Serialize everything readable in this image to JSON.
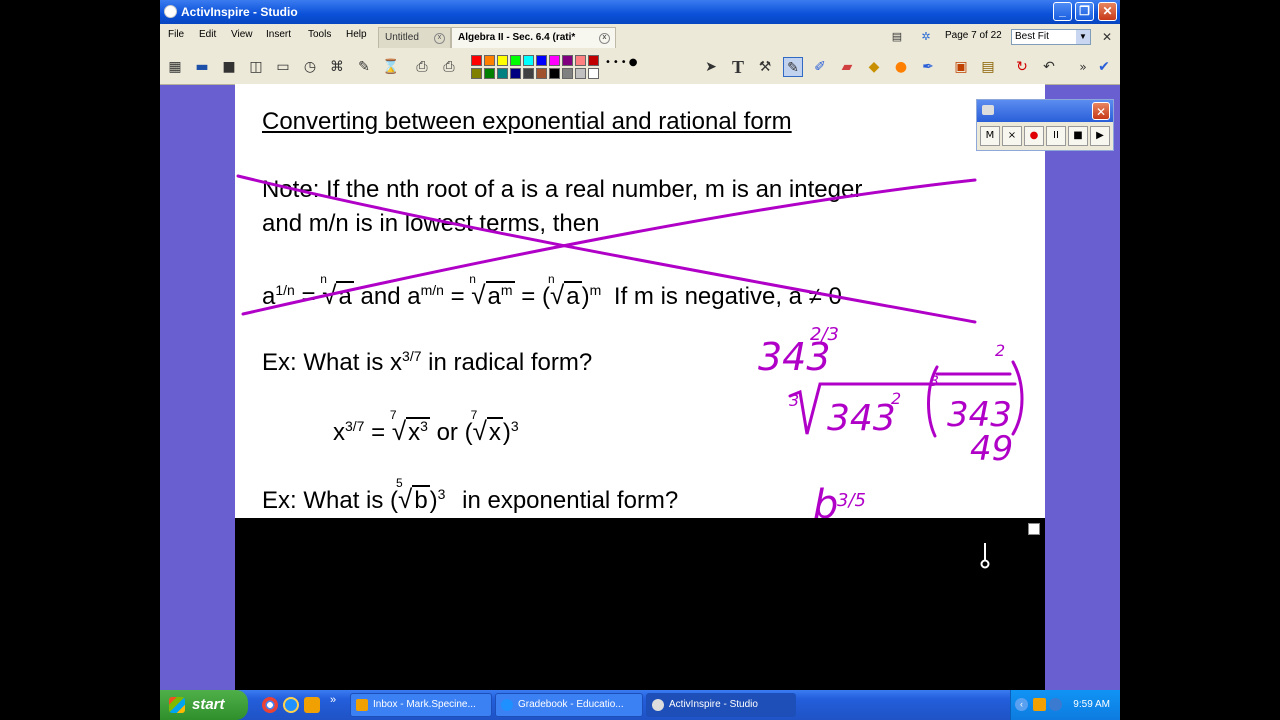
{
  "window": {
    "title": "ActivInspire - Studio",
    "controls": [
      "minimize",
      "maximize",
      "close"
    ]
  },
  "menubar": {
    "items": [
      "File",
      "Edit",
      "View",
      "Insert",
      "Tools",
      "Help"
    ],
    "tabs": [
      {
        "label": "Untitled",
        "active": false
      },
      {
        "label": "Algebra II - Sec. 6.4 (rati*",
        "active": true
      }
    ],
    "page_info": "Page 7 of 22",
    "zoom": "Best Fit"
  },
  "toolbar": {
    "icons": [
      "browser-icon",
      "flipchart-icon",
      "save-icon",
      "dual-user-icon",
      "screen-icon",
      "clock-icon",
      "camera-icon",
      "desktop-annotate-icon",
      "erase-icon",
      "print-icon",
      "print-icon-2"
    ],
    "palette": [
      "#ff0000",
      "#ff7f00",
      "#ffff00",
      "#00ff00",
      "#00ffff",
      "#0000ff",
      "#ff00ff",
      "#800080",
      "#ff8080",
      "#c00000",
      "#808000",
      "#008000",
      "#008080",
      "#000080",
      "#404040",
      "#000000",
      "#808080",
      "#c0c0c0",
      "#ffffff",
      "#a0522d"
    ],
    "tools": [
      "select-icon",
      "text-icon",
      "magic-ink-icon",
      "pen-icon",
      "highlighter-icon",
      "eraser-icon",
      "fill-icon",
      "shape-icon",
      "marker-icon",
      "page-icon",
      "reset-icon",
      "undo-icon",
      "more-icon",
      "tools-icon"
    ]
  },
  "page": {
    "heading": "Converting between exponential and rational form",
    "note_line1": "Note:  If the nth root of a is a real number, m is an integer",
    "note_line2": "and m/n is in lowest terms, then",
    "rule": {
      "a": "a",
      "exp1": "1/n",
      "eq": "=",
      "n": "n",
      "and": "and a",
      "expmn": "m/n",
      "am": "a",
      "m": "m",
      "open": "(",
      "close": ")",
      "condition": "If m is negative, a ≠ 0"
    },
    "ex1_prefix": "Ex:  What is x",
    "ex1_exp": "3/7",
    "ex1_suffix": "in radical form?",
    "ex1_answer": {
      "x": "x",
      "exp": "3/7",
      "eq": "=",
      "idx": "7",
      "x3": "x",
      "three": "3",
      "or": "or (",
      "x2": "x",
      "close": ")"
    },
    "ex2_prefix": "Ex:  What is (",
    "ex2_idx": "5",
    "ex2_b": "b",
    "ex2_close": ")",
    "ex2_exp": "3",
    "ex2_suffix": "in exponential form?"
  },
  "handwriting": {
    "color": "#b000c8",
    "a1": "343",
    "a1_exp": "2/3",
    "root_idx": "3",
    "inner": "343",
    "inner_exp": "2",
    "inner2": "343",
    "outer_exp": "2",
    "result": "49",
    "b_answer": "b",
    "b_exp": "3/5"
  },
  "recorder": {
    "buttons": [
      "M",
      "×",
      "●",
      "II",
      "■",
      "▶"
    ]
  },
  "taskbar": {
    "start": "start",
    "tasks": [
      {
        "label": "Inbox - Mark.Specine...",
        "active": false
      },
      {
        "label": "Gradebook - Educatio...",
        "active": false
      },
      {
        "label": "ActivInspire - Studio",
        "active": true
      }
    ],
    "clock": "9:59 AM"
  }
}
